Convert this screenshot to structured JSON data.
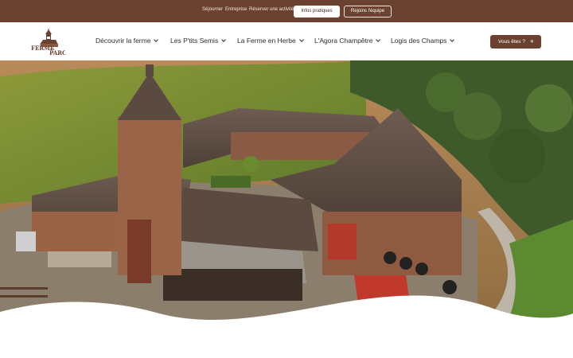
{
  "topbar": {
    "links": [
      "Séjourner",
      "Entreprise",
      "Réserver une activité"
    ],
    "primary_button": "Infos pratiques",
    "secondary_button": "Rejoins l'équipe",
    "background": "#6b4230"
  },
  "brand": {
    "logo_text_top": "FERME",
    "logo_text_conj": "du",
    "logo_text_bottom": "PARC"
  },
  "nav": {
    "items": [
      {
        "label": "Découvrir la ferme",
        "icon": "chevron-down-icon"
      },
      {
        "label": "Les P'tits Semis",
        "icon": "chevron-down-icon"
      },
      {
        "label": "La Ferme en Herbe",
        "icon": "chevron-down-icon"
      },
      {
        "label": "L'Agora Champêtre",
        "icon": "chevron-down-icon"
      },
      {
        "label": "Logis des Champs",
        "icon": "chevron-down-icon"
      }
    ],
    "cta": {
      "label": "Vous êtes ?",
      "icon": "plus-icon"
    }
  },
  "hero": {
    "image": "aerial-farm-photo",
    "accent": "#6b4230"
  }
}
